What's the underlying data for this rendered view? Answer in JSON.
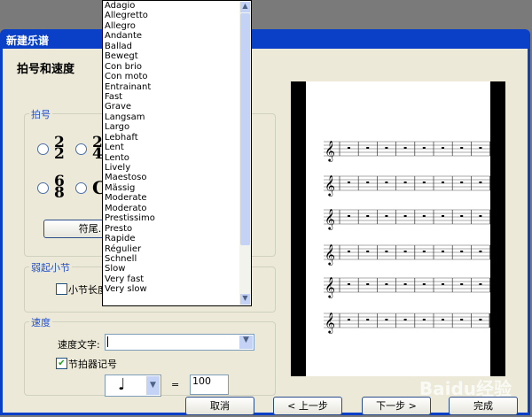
{
  "window": {
    "title": "新建乐谱"
  },
  "page_heading": "拍号和速度",
  "time_signature": {
    "legend": "拍号",
    "options": [
      {
        "num": "2",
        "den": "2"
      },
      {
        "num": "2",
        "den": "4"
      },
      {
        "num": "6",
        "den": "8"
      },
      {
        "symbol": "C"
      }
    ],
    "button": "符尾..."
  },
  "pickup": {
    "legend": "弱起小节",
    "checkbox_label": "小节长度"
  },
  "tempo": {
    "legend": "速度",
    "text_label": "速度文字:",
    "text_value": "",
    "metronome_label": "节拍器记号",
    "metronome_checked": true,
    "note_symbol": "♩",
    "equals": "=",
    "bpm": "100"
  },
  "tempo_list": [
    "Adagio",
    "Allegretto",
    "Allegro",
    "Andante",
    "Ballad",
    "Bewegt",
    "Con brio",
    "Con moto",
    "Entrainant",
    "Fast",
    "Grave",
    "Langsam",
    "Largo",
    "Lebhaft",
    "Lent",
    "Lento",
    "Lively",
    "Maestoso",
    "Mässig",
    "Moderate",
    "Moderato",
    "Prestissimo",
    "Presto",
    "Rapide",
    "Régulier",
    "Schnell",
    "Slow",
    "Very fast",
    "Very slow"
  ],
  "buttons": {
    "cancel": "取消",
    "back": "< 上一步",
    "next": "下一步 >",
    "finish": "完成"
  },
  "watermark": "Baidu经验"
}
